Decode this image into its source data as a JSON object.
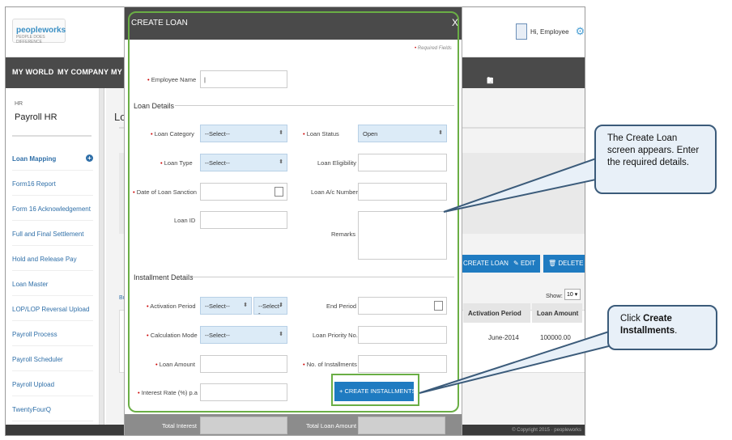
{
  "header": {
    "logo": "peopleworks",
    "logo_tagline": "PEOPLE DOES DIFFERENCE",
    "greeting": "Hi, Employee"
  },
  "nav": {
    "items": [
      "MY WORLD",
      "MY COMPANY",
      "MY S"
    ]
  },
  "sidebar": {
    "section": "HR",
    "title": "Payroll HR",
    "items": [
      {
        "label": "Loan Mapping"
      },
      {
        "label": "Form16 Report"
      },
      {
        "label": "Form 16 Acknowledgement"
      },
      {
        "label": "Full and Final Settlement"
      },
      {
        "label": "Hold and Release Pay"
      },
      {
        "label": "Loan Master"
      },
      {
        "label": "LOP/LOP Reversal Upload"
      },
      {
        "label": "Payroll Process"
      },
      {
        "label": "Payroll Scheduler"
      },
      {
        "label": "Payroll Upload"
      },
      {
        "label": "TwentyFourQ"
      }
    ]
  },
  "background": {
    "heading_partial": "Lo",
    "bulk_link": "Bulk",
    "buttons": {
      "create": "CREATE LOAN",
      "edit": "EDIT",
      "delete": "DELETE"
    },
    "show_label": "Show:",
    "show_value": "10",
    "columns": [
      "Activation Period",
      "Loan Amount"
    ],
    "row": {
      "activation": "June-2014",
      "amount": "100000.00"
    },
    "copyright": "© Copyright 2015 · peopleworks"
  },
  "modal": {
    "title": "CREATE LOAN",
    "close": "X",
    "required_note": "Required Fields",
    "employee_name_label": "Employee Name",
    "employee_name_value": "|",
    "loan_details": "Loan Details",
    "loan_category_label": "Loan Category",
    "loan_category_value": "--Select--",
    "loan_status_label": "Loan Status",
    "loan_status_value": "Open",
    "loan_type_label": "Loan Type",
    "loan_type_value": "--Select--",
    "loan_eligibility_label": "Loan Eligibility",
    "date_sanction_label": "Date of Loan Sanction",
    "loan_ac_label": "Loan A/c Number",
    "loan_id_label": "Loan ID",
    "remarks_label": "Remarks",
    "installment_details": "Installment Details",
    "activation_period_label": "Activation Period",
    "activation_period_value1": "--Select--",
    "activation_period_value2": "--Select--",
    "end_period_label": "End Period",
    "calculation_mode_label": "Calculation Mode",
    "calculation_mode_value": "--Select--",
    "loan_priority_label": "Loan Priority No.",
    "loan_amount_label": "Loan Amount",
    "no_installments_label": "No. of Installments",
    "interest_rate_label": "Interest Rate (%) p.a",
    "create_installments": "CREATE INSTALLMENTS",
    "total_interest_label": "Total Interest",
    "total_loan_amount_label": "Total Loan Amount"
  },
  "callouts": {
    "first": "The Create Loan screen appears. Enter the required details.",
    "second_prefix": "Click ",
    "second_bold": "Create Installments",
    "second_suffix": "."
  }
}
